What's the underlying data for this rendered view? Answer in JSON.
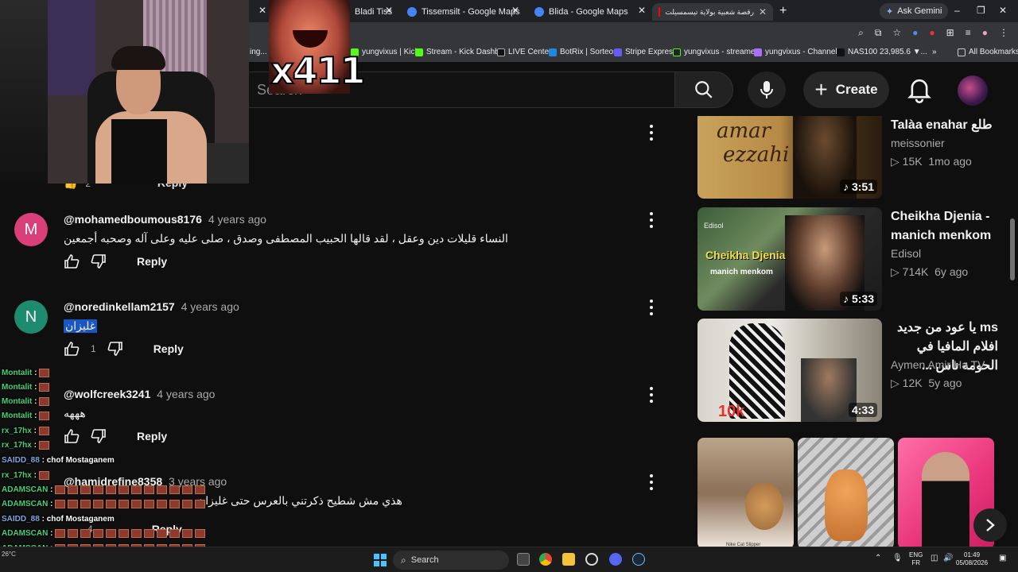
{
  "browser": {
    "tabs": [
      {
        "title": "Bladi Tiss"
      },
      {
        "title": "Tissemsilt - Google Maps"
      },
      {
        "title": "Blida - Google Maps"
      },
      {
        "title": "رقصة شعبية بولاية تيسمسيلت"
      }
    ],
    "ask_gemini": "Ask Gemini",
    "bookmarks": [
      "ing...",
      "yungvixus | Kick",
      "Stream - Kick Dashb...",
      "LIVE Center",
      "BotRix | Sorteos",
      "Stripe Express",
      "yungvixus - streame...",
      "yungvixus - Channel...",
      "NAS100 23,985.6 ▼...",
      "All Bookmarks"
    ]
  },
  "youtube": {
    "search_placeholder": "Search",
    "create_label": "Create"
  },
  "overlay": {
    "emote_count": "x411"
  },
  "comments": [
    {
      "initial": "M",
      "avatar_color": "#d9407a",
      "handle": "@mohamedboumous8176",
      "ago": "4 years ago",
      "text": "النساء قليلات دين وعقل ، لقد قالها الحبيب المصطفى وصدق ، صلى عليه وعلى آله وصحبه أجمعين",
      "likes": "",
      "reply": "Reply"
    },
    {
      "initial": "N",
      "avatar_color": "#1e8b6f",
      "handle": "@noredinkellam2157",
      "ago": "4 years ago",
      "text": "غليزان",
      "likes": "1",
      "reply": "Reply"
    },
    {
      "initial": "",
      "avatar_color": "#3a3a3a",
      "handle": "@wolfcreek3241",
      "ago": "4 years ago",
      "text": "هههه",
      "likes": "",
      "reply": "Reply"
    },
    {
      "initial": "",
      "avatar_color": "#3a3a3a",
      "handle": "@hamidrefine8358",
      "ago": "3 years ago",
      "text": "هذي مش شطيح ذكرتني بالعرس حتى غليزان",
      "likes": "4",
      "reply": "Reply"
    }
  ],
  "partial_reply": "Reply",
  "partial_likes": "2",
  "sidebar": [
    {
      "title": "Talàa enahar طلع",
      "channel": "meissonier",
      "views": "15K",
      "ago": "1mo ago",
      "duration": "3:51",
      "thumb_text1": "amar",
      "thumb_text2": "ezzahi"
    },
    {
      "title": "Cheikha Djenia - manich menkom",
      "channel": "Edisol",
      "views": "714K",
      "ago": "6y ago",
      "duration": "5:33",
      "thumb_text1": "Cheikha Djenia",
      "thumb_text2": "manich menkom",
      "thumb_text3": "Edisol"
    },
    {
      "title": "ms يا عود من جديد افلام المافيا في الحومة ناس ...",
      "channel": "Aymen Amir Ha TV",
      "views": "12K",
      "ago": "5y ago",
      "duration": "4:33",
      "thumb_text1": "10k"
    }
  ],
  "shorts_caption": "Nike Cat Slipper",
  "chat": [
    {
      "user": "Montalit",
      "msg": "",
      "color": "#44d17a"
    },
    {
      "user": "Montalit",
      "msg": "",
      "color": "#44d17a"
    },
    {
      "user": "Montalit",
      "msg": "",
      "color": "#44d17a"
    },
    {
      "user": "Montalit",
      "msg": "",
      "color": "#44d17a"
    },
    {
      "user": "rx_17hx",
      "msg": "",
      "color": "#44d17a"
    },
    {
      "user": "rx_17hx",
      "msg": "",
      "color": "#44d17a"
    },
    {
      "user": "SAIDD_88",
      "msg": "chof Mostaganem",
      "color": "#7ea6d9"
    },
    {
      "user": "rx_17hx",
      "msg": "",
      "color": "#44d17a"
    },
    {
      "user": "ADAMSCAN",
      "msg": "",
      "color": "#44d17a"
    },
    {
      "user": "ADAMSCAN",
      "msg": "",
      "color": "#44d17a"
    },
    {
      "user": "SAIDD_88",
      "msg": "chof Mostaganem",
      "color": "#7ea6d9"
    },
    {
      "user": "ADAMSCAN",
      "msg": "",
      "color": "#44d17a"
    },
    {
      "user": "ADAMSCAN",
      "msg": "",
      "color": "#44d17a"
    },
    {
      "user": "ADAMSCAN",
      "msg": "",
      "color": "#44d17a"
    }
  ],
  "taskbar": {
    "search": "Search",
    "lang1": "ENG",
    "lang2": "FR",
    "time": "01:49",
    "date": "05/08/2026",
    "weather": "26°C"
  }
}
